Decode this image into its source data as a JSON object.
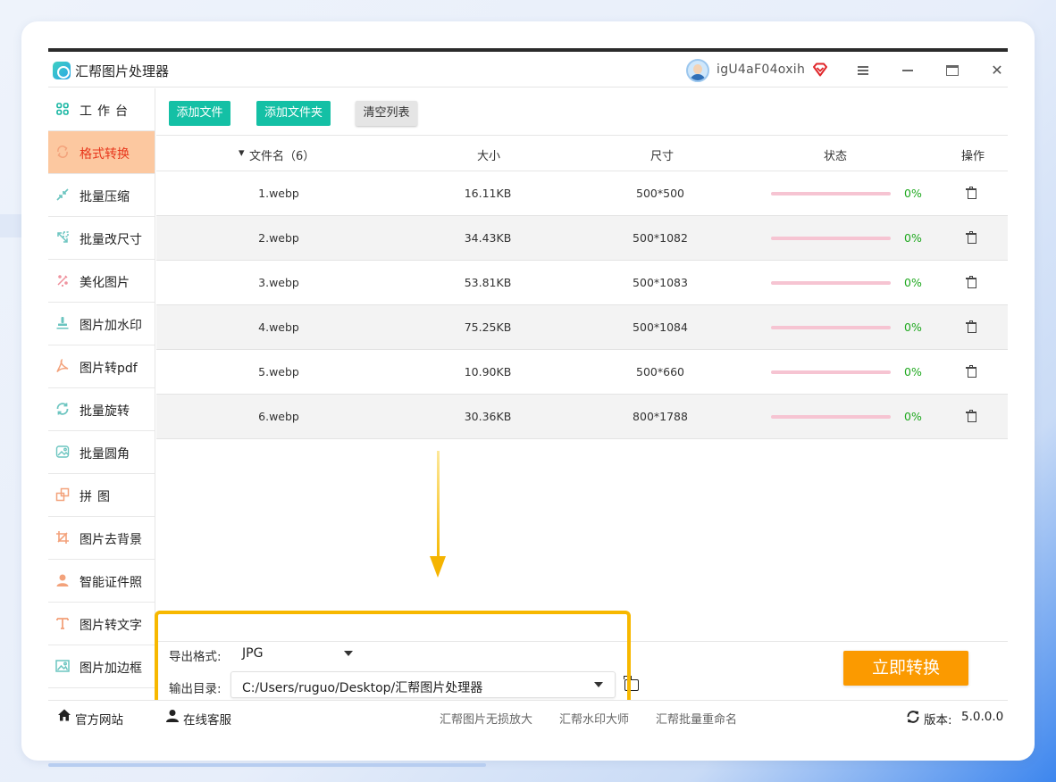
{
  "app": {
    "title": "汇帮图片处理器",
    "username": "igU4aF04oxih",
    "vip_icon": "diamond-icon"
  },
  "window_controls": {
    "menu": "≡",
    "minimize": "—",
    "maximize": "□",
    "close": "✕"
  },
  "sidebar": {
    "items": [
      {
        "label": "工作台",
        "icon": "grid-icon"
      },
      {
        "label": "格式转换",
        "icon": "convert-icon",
        "active": true
      },
      {
        "label": "批量压缩",
        "icon": "compress-icon"
      },
      {
        "label": "批量改尺寸",
        "icon": "resize-icon"
      },
      {
        "label": "美化图片",
        "icon": "beautify-icon"
      },
      {
        "label": "图片加水印",
        "icon": "watermark-icon"
      },
      {
        "label": "图片转pdf",
        "icon": "pdf-icon"
      },
      {
        "label": "批量旋转",
        "icon": "rotate-icon"
      },
      {
        "label": "批量圆角",
        "icon": "rounded-image-icon"
      },
      {
        "label": "拼图",
        "icon": "puzzle-icon"
      },
      {
        "label": "图片去背景",
        "icon": "crop-icon"
      },
      {
        "label": "智能证件照",
        "icon": "person-icon"
      },
      {
        "label": "图片转文字",
        "icon": "text-icon"
      },
      {
        "label": "图片加边框",
        "icon": "frame-icon"
      }
    ]
  },
  "toolbar": {
    "add_file": "添加文件",
    "add_folder": "添加文件夹",
    "clear_list": "清空列表"
  },
  "table": {
    "headers": {
      "filename": "文件名（6）",
      "size": "大小",
      "dimensions": "尺寸",
      "status": "状态",
      "actions": "操作"
    },
    "rows": [
      {
        "filename": "1.webp",
        "size": "16.11KB",
        "dimensions": "500*500",
        "progress": "0%"
      },
      {
        "filename": "2.webp",
        "size": "34.43KB",
        "dimensions": "500*1082",
        "progress": "0%"
      },
      {
        "filename": "3.webp",
        "size": "53.81KB",
        "dimensions": "500*1083",
        "progress": "0%"
      },
      {
        "filename": "4.webp",
        "size": "75.25KB",
        "dimensions": "500*1084",
        "progress": "0%"
      },
      {
        "filename": "5.webp",
        "size": "10.90KB",
        "dimensions": "500*660",
        "progress": "0%"
      },
      {
        "filename": "6.webp",
        "size": "30.36KB",
        "dimensions": "800*1788",
        "progress": "0%"
      }
    ]
  },
  "settings": {
    "format_label": "导出格式:",
    "format_value": "JPG",
    "output_label": "输出目录:",
    "output_value": "C:/Users/ruguo/Desktop/汇帮图片处理器"
  },
  "convert_button": "立即转换",
  "footer": {
    "official_site": "官方网站",
    "support": "在线客服",
    "links": [
      "汇帮图片无损放大",
      "汇帮水印大师",
      "汇帮批量重命名"
    ],
    "version_label": "版本:",
    "version": "5.0.0.0"
  },
  "colors": {
    "accent_teal": "#14c0a5",
    "active_bg": "#fcc8a0",
    "active_text": "#e8371c",
    "convert_orange": "#fb9a00",
    "highlight_yellow": "#f7b800",
    "progress_pink": "#f6c4d2",
    "percent_green": "#1ea81e"
  }
}
